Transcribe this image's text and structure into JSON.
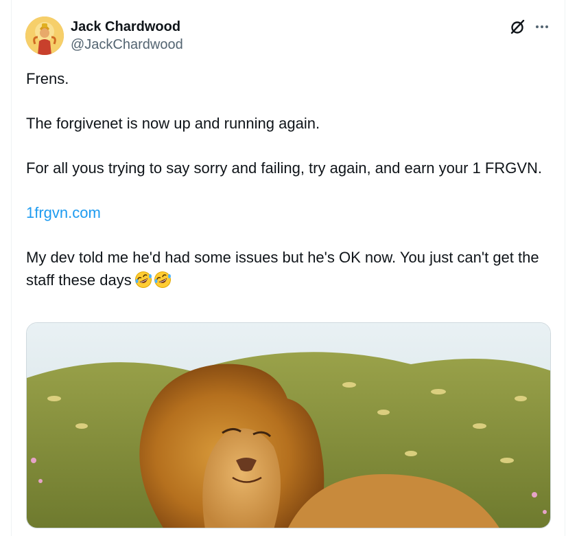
{
  "author": {
    "name": "Jack Chardwood",
    "handle": "@JackChardwood",
    "avatar_icon": "avatar-icon"
  },
  "actions": {
    "grok_icon": "grok-icon",
    "more_icon": "more-icon"
  },
  "tweet": {
    "paragraphs": [
      "Frens.",
      "The forgivenet is now up and running again.",
      "For all yous trying to say sorry and failing, try again, and earn your 1 FRGVN."
    ],
    "link": "1frgvn.com",
    "closing": "My dev told me he'd had some issues but he's OK now. You just can't get the staff these days",
    "emoji": [
      "🤣",
      "🤣"
    ]
  },
  "media": {
    "icon": "lion-image"
  },
  "colors": {
    "link": "#1d9bf0",
    "text": "#0f1419",
    "secondary": "#536471"
  }
}
